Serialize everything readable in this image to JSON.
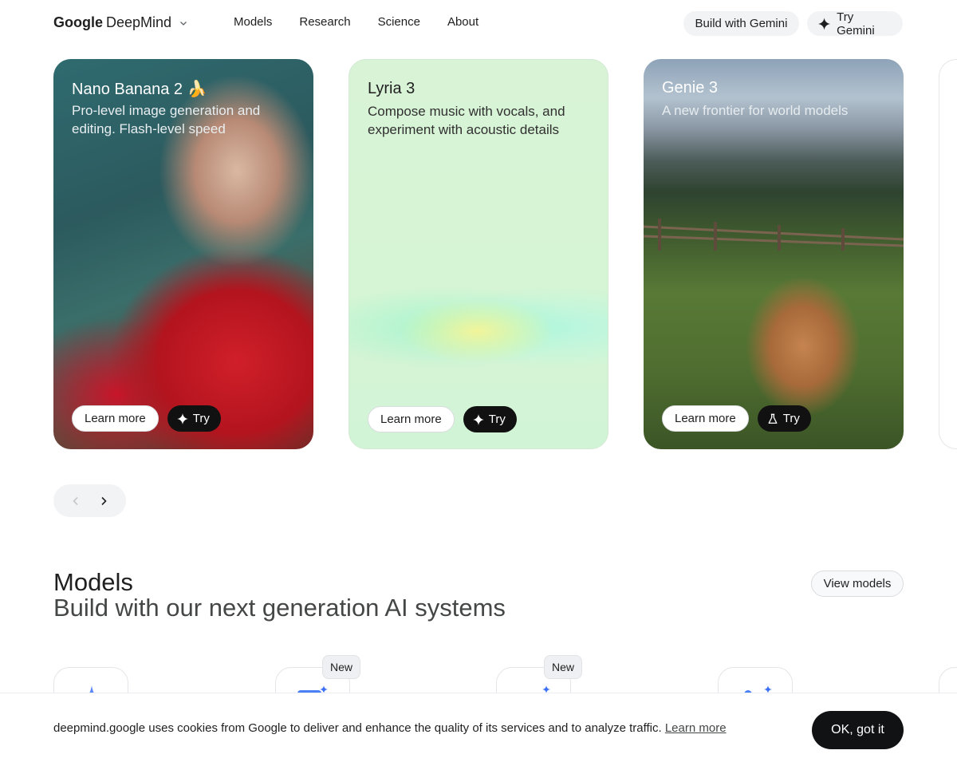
{
  "header": {
    "logo_google": "Google",
    "logo_deepmind": "DeepMind",
    "nav": [
      "Models",
      "Research",
      "Science",
      "About"
    ],
    "build_label": "Build with Gemini",
    "try_label": "Try Gemini"
  },
  "cards": [
    {
      "title": "Nano Banana 2 🍌",
      "desc": "Pro-level image generation and editing. Flash-level speed",
      "learn_label": "Learn more",
      "try_label": "Try"
    },
    {
      "title": "Lyria 3",
      "desc": "Compose music with vocals, and experiment with acoustic details",
      "learn_label": "Learn more",
      "try_label": "Try"
    },
    {
      "title": "Genie 3",
      "desc": "A new frontier for world models",
      "learn_label": "Learn more",
      "try_label": "Try"
    }
  ],
  "models": {
    "title": "Models",
    "subtitle": "Build with our next generation AI systems",
    "view_label": "View models",
    "tags": [
      "New",
      "New"
    ]
  },
  "cookie": {
    "text": "deepmind.google uses cookies from Google to deliver and enhance the quality of its services and to analyze traffic.",
    "link": "Learn more",
    "ok_label": "OK, got it"
  },
  "icons": {
    "sparkle": "sparkle-icon",
    "flask": "flask-icon",
    "chevron_left": "chevron-left-icon",
    "chevron_right": "chevron-right-icon"
  },
  "colors": {
    "accent_blue": "#3b6ff5",
    "dark_button": "#111214",
    "lyria_bg": "#d6f5d4"
  }
}
